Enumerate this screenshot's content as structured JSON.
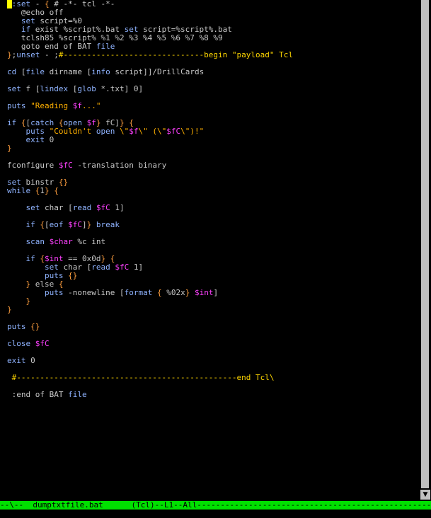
{
  "window": {
    "buffer_name": "dumptxtfile.bat",
    "mode": "(Tcl)",
    "line": "L1",
    "scroll_pos": "All"
  },
  "modeline": {
    "prefix": "--\\--  ",
    "buffer": "dumptxtfile.bat",
    "gap": "      ",
    "mode": "(Tcl)",
    "sep1": "--",
    "line": "L1",
    "sep2": "--",
    "pos": "All",
    "fill": "------------------------------------------------------------------------------------------"
  },
  "colors": {
    "background": "#000000",
    "modeline": "#00e000",
    "keyword": "#8fb3ff",
    "variable": "#ff40ff",
    "string": "#ffb000",
    "comment": "#ffd700",
    "cursor": "#ffff00"
  },
  "code": [
    [
      [
        "pln",
        " "
      ],
      [
        "kw",
        ":set"
      ],
      [
        "pln",
        " - "
      ],
      [
        "brk",
        "{"
      ],
      [
        "pln",
        " # -*- tcl -*-"
      ]
    ],
    [
      [
        "pln",
        "   @echo off"
      ]
    ],
    [
      [
        "pln",
        "   "
      ],
      [
        "kw",
        "set"
      ],
      [
        "pln",
        " script=%0"
      ]
    ],
    [
      [
        "pln",
        "   "
      ],
      [
        "kw",
        "if"
      ],
      [
        "pln",
        " exist %script%.bat "
      ],
      [
        "kw",
        "set"
      ],
      [
        "pln",
        " script=%script%.bat"
      ]
    ],
    [
      [
        "pln",
        "   tclsh85 %script% %1 %2 %3 %4 %5 %6 %7 %8 %9"
      ]
    ],
    [
      [
        "pln",
        "   goto end of BAT "
      ],
      [
        "kw",
        "file"
      ]
    ],
    [
      [
        "brk",
        "}"
      ],
      [
        "pln",
        ";"
      ],
      [
        "kw",
        "unset"
      ],
      [
        "pln",
        " - ;"
      ],
      [
        "cmt",
        "#------------------------------begin \"payload\" Tcl"
      ]
    ],
    [
      [
        "pln",
        ""
      ]
    ],
    [
      [
        "kw",
        "cd"
      ],
      [
        "pln",
        " ["
      ],
      [
        "kw",
        "file"
      ],
      [
        "pln",
        " dirname ["
      ],
      [
        "kw",
        "info"
      ],
      [
        "pln",
        " script]]/DrillCards"
      ]
    ],
    [
      [
        "pln",
        ""
      ]
    ],
    [
      [
        "kw",
        "set"
      ],
      [
        "pln",
        " f ["
      ],
      [
        "kw",
        "lindex"
      ],
      [
        "pln",
        " ["
      ],
      [
        "kw",
        "glob"
      ],
      [
        "pln",
        " *.txt] 0]"
      ]
    ],
    [
      [
        "pln",
        ""
      ]
    ],
    [
      [
        "kw",
        "puts"
      ],
      [
        "pln",
        " "
      ],
      [
        "str",
        "\"Reading "
      ],
      [
        "var",
        "$f"
      ],
      [
        "str",
        "...\""
      ]
    ],
    [
      [
        "pln",
        ""
      ]
    ],
    [
      [
        "kw",
        "if"
      ],
      [
        "pln",
        " "
      ],
      [
        "brk",
        "{"
      ],
      [
        "pln",
        "["
      ],
      [
        "kw",
        "catch"
      ],
      [
        "pln",
        " "
      ],
      [
        "brk",
        "{"
      ],
      [
        "kw",
        "open"
      ],
      [
        "pln",
        " "
      ],
      [
        "var",
        "$f"
      ],
      [
        "brk",
        "}"
      ],
      [
        "pln",
        " fC]"
      ],
      [
        "brk",
        "}"
      ],
      [
        "pln",
        " "
      ],
      [
        "brk",
        "{"
      ]
    ],
    [
      [
        "pln",
        "    "
      ],
      [
        "kw",
        "puts"
      ],
      [
        "pln",
        " "
      ],
      [
        "str",
        "\"Couldn't "
      ],
      [
        "kw",
        "open"
      ],
      [
        "pln",
        " "
      ],
      [
        "str",
        "\\\""
      ],
      [
        "var",
        "$f"
      ],
      [
        "str",
        "\\\" (\\\""
      ],
      [
        "var",
        "$fC"
      ],
      [
        "str",
        "\\\")!\""
      ]
    ],
    [
      [
        "pln",
        "    "
      ],
      [
        "kw",
        "exit"
      ],
      [
        "pln",
        " 0"
      ]
    ],
    [
      [
        "brk",
        "}"
      ]
    ],
    [
      [
        "pln",
        ""
      ]
    ],
    [
      [
        "pln",
        "fconfigure "
      ],
      [
        "var",
        "$fC"
      ],
      [
        "pln",
        " -translation binary"
      ]
    ],
    [
      [
        "pln",
        ""
      ]
    ],
    [
      [
        "kw",
        "set"
      ],
      [
        "pln",
        " binstr "
      ],
      [
        "brk",
        "{}"
      ]
    ],
    [
      [
        "kw",
        "while"
      ],
      [
        "pln",
        " "
      ],
      [
        "brk",
        "{"
      ],
      [
        "pln",
        "1"
      ],
      [
        "brk",
        "}"
      ],
      [
        "pln",
        " "
      ],
      [
        "brk",
        "{"
      ]
    ],
    [
      [
        "pln",
        ""
      ]
    ],
    [
      [
        "pln",
        "    "
      ],
      [
        "kw",
        "set"
      ],
      [
        "pln",
        " char ["
      ],
      [
        "kw",
        "read"
      ],
      [
        "pln",
        " "
      ],
      [
        "var",
        "$fC"
      ],
      [
        "pln",
        " 1]"
      ]
    ],
    [
      [
        "pln",
        ""
      ]
    ],
    [
      [
        "pln",
        "    "
      ],
      [
        "kw",
        "if"
      ],
      [
        "pln",
        " "
      ],
      [
        "brk",
        "{"
      ],
      [
        "pln",
        "["
      ],
      [
        "kw",
        "eof"
      ],
      [
        "pln",
        " "
      ],
      [
        "var",
        "$fC"
      ],
      [
        "pln",
        "]"
      ],
      [
        "brk",
        "}"
      ],
      [
        "pln",
        " "
      ],
      [
        "kw",
        "break"
      ]
    ],
    [
      [
        "pln",
        ""
      ]
    ],
    [
      [
        "pln",
        "    "
      ],
      [
        "kw",
        "scan"
      ],
      [
        "pln",
        " "
      ],
      [
        "var",
        "$char"
      ],
      [
        "pln",
        " %c int"
      ]
    ],
    [
      [
        "pln",
        ""
      ]
    ],
    [
      [
        "pln",
        "    "
      ],
      [
        "kw",
        "if"
      ],
      [
        "pln",
        " "
      ],
      [
        "brk",
        "{"
      ],
      [
        "var",
        "$int"
      ],
      [
        "pln",
        " == 0x0d"
      ],
      [
        "brk",
        "}"
      ],
      [
        "pln",
        " "
      ],
      [
        "brk",
        "{"
      ]
    ],
    [
      [
        "pln",
        "        "
      ],
      [
        "kw",
        "set"
      ],
      [
        "pln",
        " char ["
      ],
      [
        "kw",
        "read"
      ],
      [
        "pln",
        " "
      ],
      [
        "var",
        "$fC"
      ],
      [
        "pln",
        " 1]"
      ]
    ],
    [
      [
        "pln",
        "        "
      ],
      [
        "kw",
        "puts"
      ],
      [
        "pln",
        " "
      ],
      [
        "brk",
        "{}"
      ]
    ],
    [
      [
        "pln",
        "    "
      ],
      [
        "brk",
        "}"
      ],
      [
        "pln",
        " else "
      ],
      [
        "brk",
        "{"
      ]
    ],
    [
      [
        "pln",
        "        "
      ],
      [
        "kw",
        "puts"
      ],
      [
        "pln",
        " -nonewline ["
      ],
      [
        "kw",
        "format"
      ],
      [
        "pln",
        " "
      ],
      [
        "brk",
        "{"
      ],
      [
        "pln",
        " %02x"
      ],
      [
        "brk",
        "}"
      ],
      [
        "pln",
        " "
      ],
      [
        "var",
        "$int"
      ],
      [
        "pln",
        "]"
      ]
    ],
    [
      [
        "pln",
        "    "
      ],
      [
        "brk",
        "}"
      ]
    ],
    [
      [
        "brk",
        "}"
      ]
    ],
    [
      [
        "pln",
        ""
      ]
    ],
    [
      [
        "kw",
        "puts"
      ],
      [
        "pln",
        " "
      ],
      [
        "brk",
        "{}"
      ]
    ],
    [
      [
        "pln",
        ""
      ]
    ],
    [
      [
        "kw",
        "close"
      ],
      [
        "pln",
        " "
      ],
      [
        "var",
        "$fC"
      ]
    ],
    [
      [
        "pln",
        ""
      ]
    ],
    [
      [
        "kw",
        "exit"
      ],
      [
        "pln",
        " 0"
      ]
    ],
    [
      [
        "pln",
        ""
      ]
    ],
    [
      [
        "pln",
        " "
      ],
      [
        "cmt",
        "#-----------------------------------------------end Tcl\\"
      ]
    ],
    [
      [
        "pln",
        ""
      ]
    ],
    [
      [
        "pln",
        " :end of BAT "
      ],
      [
        "kw",
        "file"
      ]
    ]
  ]
}
